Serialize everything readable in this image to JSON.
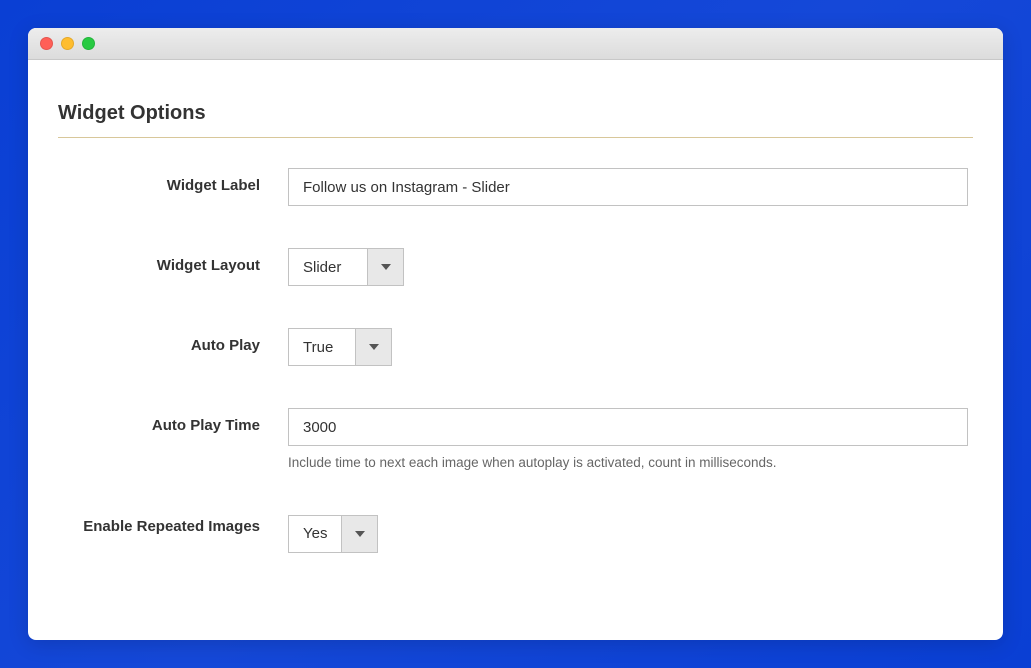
{
  "section_title": "Widget Options",
  "fields": {
    "widget_label": {
      "label": "Widget Label",
      "value": "Follow us on Instagram - Slider"
    },
    "widget_layout": {
      "label": "Widget Layout",
      "value": "Slider"
    },
    "auto_play": {
      "label": "Auto Play",
      "value": "True"
    },
    "auto_play_time": {
      "label": "Auto Play Time",
      "value": "3000",
      "help": "Include time to next each image when autoplay is activated, count in milliseconds."
    },
    "enable_repeated": {
      "label": "Enable Repeated Images",
      "value": "Yes"
    }
  }
}
